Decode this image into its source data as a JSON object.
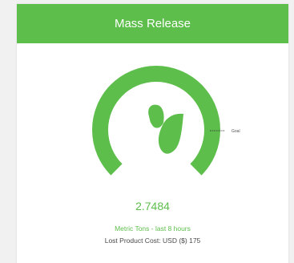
{
  "widget": {
    "title": "Mass Release",
    "value": "2.7484",
    "unit_label": "Metric Tons - last 8 hours",
    "cost_label": "Lost Product Cost:",
    "cost_currency": "USD ($)",
    "cost_value": "175",
    "goal_label": "Goal",
    "icon": "leaf-icon",
    "progress_fraction": 1.0
  },
  "colors": {
    "accent": "#5dbe4b",
    "header_text": "#ffffff",
    "muted_text": "#4a4a4a"
  }
}
